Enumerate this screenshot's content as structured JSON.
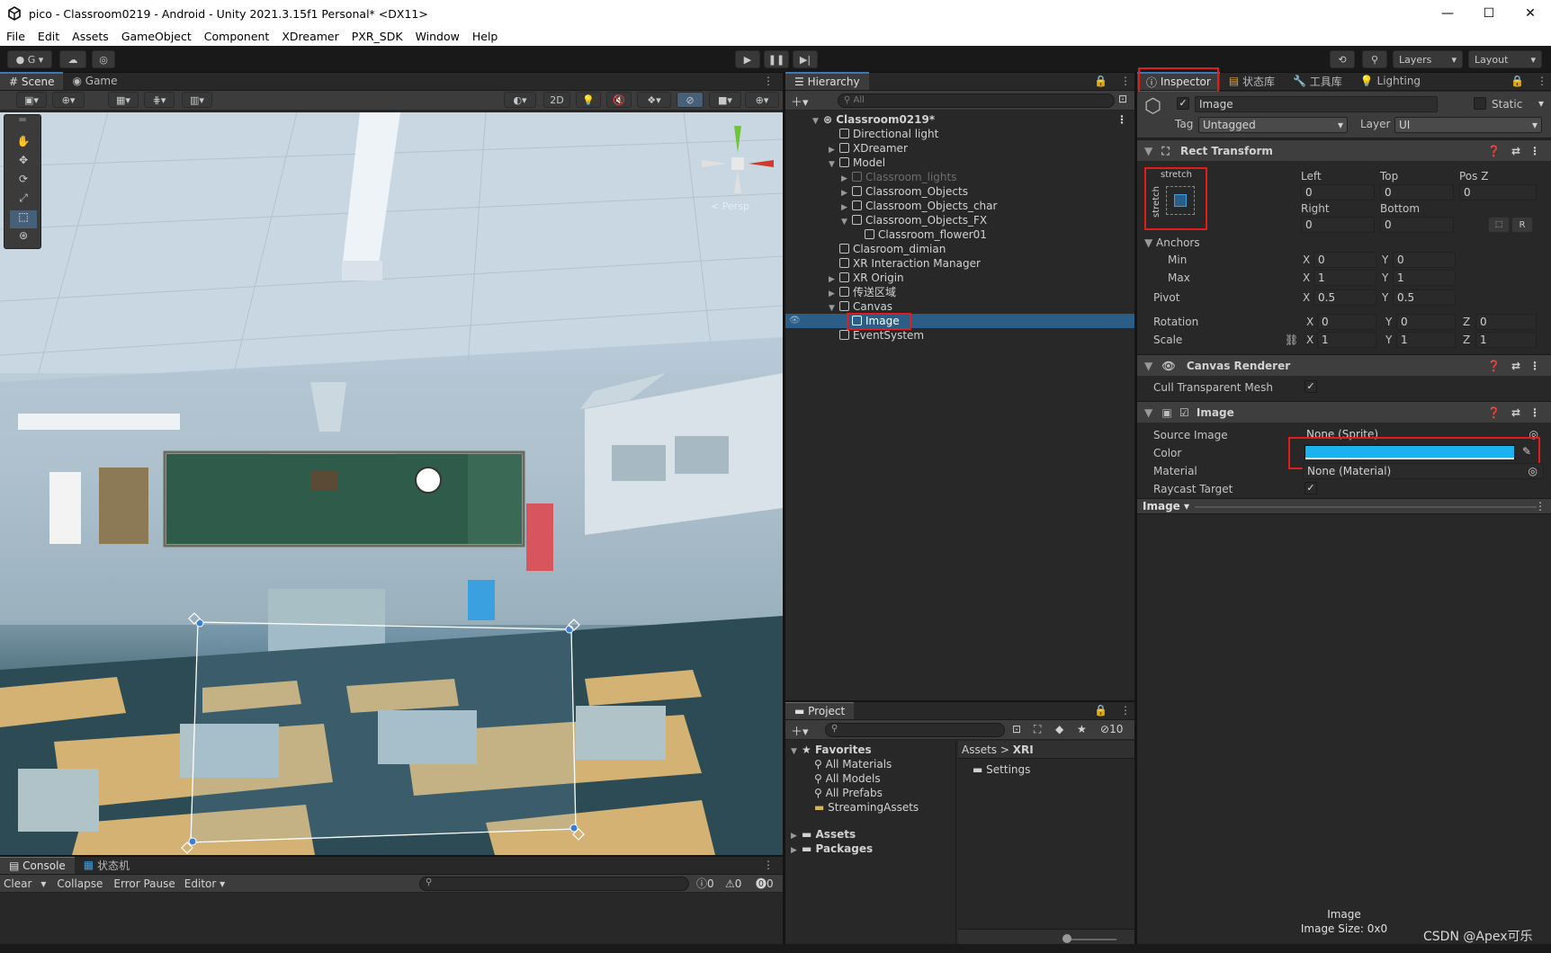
{
  "window": {
    "title": "pico - Classroom0219 - Android - Unity 2021.3.15f1 Personal* <DX11>",
    "minimize": "—",
    "maximize": "☐",
    "close": "✕"
  },
  "menu": [
    "File",
    "Edit",
    "Assets",
    "GameObject",
    "Component",
    "XDreamer",
    "PXR_SDK",
    "Window",
    "Help"
  ],
  "toolbar": {
    "account": "G",
    "layers": "Layers",
    "layout": "Layout"
  },
  "scene_tabs": {
    "scene": "Scene",
    "game": "Game",
    "twod": "2D",
    "persp": "< Persp"
  },
  "hierarchy": {
    "tab": "Hierarchy",
    "search": "All",
    "root": "Classroom0219*",
    "items": [
      {
        "label": "Directional light",
        "level": 1,
        "arrow": ""
      },
      {
        "label": "XDreamer",
        "level": 1,
        "arrow": "▶"
      },
      {
        "label": "Model",
        "level": 1,
        "arrow": "▼"
      },
      {
        "label": "Classroom_lights",
        "level": 2,
        "arrow": "▶",
        "dim": true
      },
      {
        "label": "Classroom_Objects",
        "level": 2,
        "arrow": "▶"
      },
      {
        "label": "Classroom_Objects_char",
        "level": 2,
        "arrow": "▶"
      },
      {
        "label": "Classroom_Objects_FX",
        "level": 2,
        "arrow": "▼"
      },
      {
        "label": "Classroom_flower01",
        "level": 3,
        "arrow": ""
      },
      {
        "label": "Clasroom_dimian",
        "level": 1,
        "arrow": ""
      },
      {
        "label": "XR Interaction Manager",
        "level": 1,
        "arrow": ""
      },
      {
        "label": "XR Origin",
        "level": 1,
        "arrow": "▶"
      },
      {
        "label": "传送区域",
        "level": 1,
        "arrow": "▶"
      },
      {
        "label": "Canvas",
        "level": 1,
        "arrow": "▼"
      },
      {
        "label": "Image",
        "level": 2,
        "arrow": "",
        "selected": true
      },
      {
        "label": "EventSystem",
        "level": 1,
        "arrow": ""
      }
    ]
  },
  "inspector": {
    "tabs": [
      "Inspector",
      "状态库",
      "工具库",
      "Lighting"
    ],
    "object_name": "Image",
    "static_label": "Static",
    "tag_label": "Tag",
    "tag_value": "Untagged",
    "layer_label": "Layer",
    "layer_value": "UI",
    "rect": {
      "title": "Rect Transform",
      "stretch_top": "stretch",
      "stretch_side": "stretch",
      "left_label": "Left",
      "left": "0",
      "top_label": "Top",
      "top": "0",
      "posz_label": "Pos Z",
      "posz": "0",
      "right_label": "Right",
      "right": "0",
      "bottom_label": "Bottom",
      "bottom": "0",
      "r_btn": "R",
      "anchors": "Anchors",
      "min": "Min",
      "min_x": "0",
      "min_y": "0",
      "max": "Max",
      "max_x": "1",
      "max_y": "1",
      "pivot": "Pivot",
      "pivot_x": "0.5",
      "pivot_y": "0.5",
      "rotation": "Rotation",
      "rot_x": "0",
      "rot_y": "0",
      "rot_z": "0",
      "scale": "Scale",
      "sc_x": "1",
      "sc_y": "1",
      "sc_z": "1",
      "x": "X",
      "y": "Y",
      "z": "Z"
    },
    "canvas_renderer": {
      "title": "Canvas Renderer",
      "cull": "Cull Transparent Mesh"
    },
    "image": {
      "title": "Image",
      "source_label": "Source Image",
      "source_value": "None (Sprite)",
      "color_label": "Color",
      "color_value": "#1ab3ef",
      "material_label": "Material",
      "material_value": "None (Material)",
      "raycast_label": "Raycast Target"
    },
    "preview_title": "Image ▾",
    "footer_name": "Image",
    "footer_size": "Image Size: 0x0"
  },
  "console": {
    "tabs": [
      "Console",
      "状态机"
    ],
    "clear": "Clear",
    "collapse": "Collapse",
    "error_pause": "Error Pause",
    "editor": "Editor",
    "c1": "0",
    "c2": "0",
    "c3": "0"
  },
  "project": {
    "tab": "Project",
    "count": "10",
    "favorites": "Favorites",
    "fav_items": [
      "All Materials",
      "All Models",
      "All Prefabs",
      "StreamingAssets"
    ],
    "assets": "Assets",
    "packages": "Packages",
    "crumb_assets": "Assets",
    "crumb_xri": "XRI",
    "folder": "Settings"
  },
  "watermark": "CSDN @Apex可乐"
}
